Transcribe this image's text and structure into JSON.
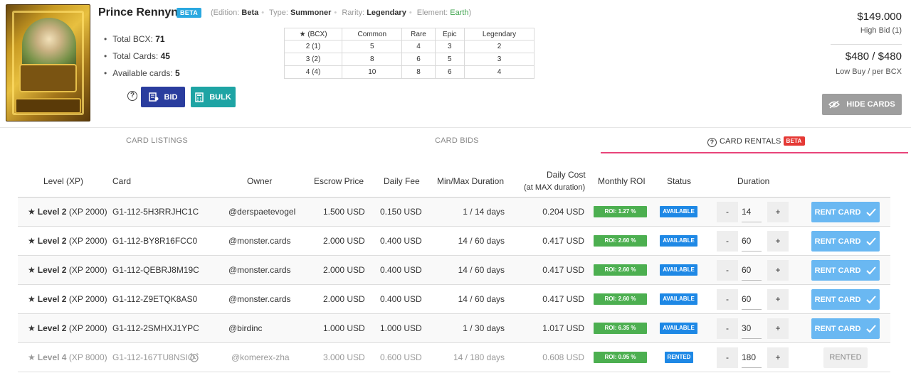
{
  "card": {
    "name": "Prince Rennyn",
    "badge": "BETA",
    "meta": {
      "edition_label": "(Edition:",
      "edition": "Beta",
      "type_label": "Type:",
      "type": "Summoner",
      "rarity_label": "Rarity:",
      "rarity": "Legendary",
      "element_label": "Element:",
      "element": "Earth",
      "close": ")"
    },
    "stats": [
      {
        "label": "Total BCX:",
        "value": "71"
      },
      {
        "label": "Total Cards:",
        "value": "45"
      },
      {
        "label": "Available cards:",
        "value": "5"
      }
    ],
    "bid_label": "BID",
    "bulk_label": "BULK"
  },
  "bcx_table": {
    "headers": [
      "★ (BCX)",
      "Common",
      "Rare",
      "Epic",
      "Legendary"
    ],
    "rows": [
      [
        "2 (1)",
        "5",
        "4",
        "3",
        "2"
      ],
      [
        "3 (2)",
        "8",
        "6",
        "5",
        "3"
      ],
      [
        "4 (4)",
        "10",
        "8",
        "6",
        "4"
      ]
    ]
  },
  "prices": {
    "high_bid": "$149.000",
    "high_bid_label": "High Bid (1)",
    "low_buy": "$480 / $480",
    "low_buy_label": "Low Buy / per BCX",
    "hide_cards_label": "HIDE CARDS"
  },
  "tabs": {
    "listings": "CARD LISTINGS",
    "bids": "CARD BIDS",
    "rentals": "CARD RENTALS",
    "rentals_badge": "BETA"
  },
  "rentals": {
    "headers": {
      "level": "Level (XP)",
      "card": "Card",
      "owner": "Owner",
      "escrow": "Escrow Price",
      "daily_fee": "Daily Fee",
      "duration_range": "Min/Max Duration",
      "daily_cost": "Daily Cost",
      "daily_cost_sub": "(at MAX duration)",
      "roi": "Monthly ROI",
      "status": "Status",
      "duration": "Duration"
    },
    "rows": [
      {
        "level": "Level 2",
        "xp": "(XP 2000)",
        "card": "G1-112-5H3RRJHC1C",
        "owner": "@derspaetevogel",
        "escrow": "1.500 USD",
        "fee": "0.150 USD",
        "range": "1 / 14 days",
        "cost": "0.204 USD",
        "roi": "ROI: 1.27 %",
        "status": "AVAILABLE",
        "duration": "14",
        "action": "RENT CARD"
      },
      {
        "level": "Level 2",
        "xp": "(XP 2000)",
        "card": "G1-112-BY8R16FCC0",
        "owner": "@monster.cards",
        "escrow": "2.000 USD",
        "fee": "0.400 USD",
        "range": "14 / 60 days",
        "cost": "0.417 USD",
        "roi": "ROI: 2.60 %",
        "status": "AVAILABLE",
        "duration": "60",
        "action": "RENT CARD"
      },
      {
        "level": "Level 2",
        "xp": "(XP 2000)",
        "card": "G1-112-QEBRJ8M19C",
        "owner": "@monster.cards",
        "escrow": "2.000 USD",
        "fee": "0.400 USD",
        "range": "14 / 60 days",
        "cost": "0.417 USD",
        "roi": "ROI: 2.60 %",
        "status": "AVAILABLE",
        "duration": "60",
        "action": "RENT CARD"
      },
      {
        "level": "Level 2",
        "xp": "(XP 2000)",
        "card": "G1-112-Z9ETQK8AS0",
        "owner": "@monster.cards",
        "escrow": "2.000 USD",
        "fee": "0.400 USD",
        "range": "14 / 60 days",
        "cost": "0.417 USD",
        "roi": "ROI: 2.60 %",
        "status": "AVAILABLE",
        "duration": "60",
        "action": "RENT CARD"
      },
      {
        "level": "Level 2",
        "xp": "(XP 2000)",
        "card": "G1-112-2SMHXJ1YPC",
        "owner": "@birdinc",
        "escrow": "1.000 USD",
        "fee": "1.000 USD",
        "range": "1 / 30 days",
        "cost": "1.017 USD",
        "roi": "ROI: 6.35 %",
        "status": "AVAILABLE",
        "duration": "30",
        "action": "RENT CARD"
      },
      {
        "level": "Level 4",
        "xp": "(XP 8000)",
        "card": "G1-112-167TU8NSIO",
        "owner": "@komerex-zha",
        "escrow": "3.000 USD",
        "fee": "0.600 USD",
        "range": "14 / 180 days",
        "cost": "0.608 USD",
        "roi": "ROI: 0.95 %",
        "status": "RENTED",
        "duration": "180",
        "action": "RENTED"
      }
    ],
    "minus": "-",
    "plus": "+"
  }
}
